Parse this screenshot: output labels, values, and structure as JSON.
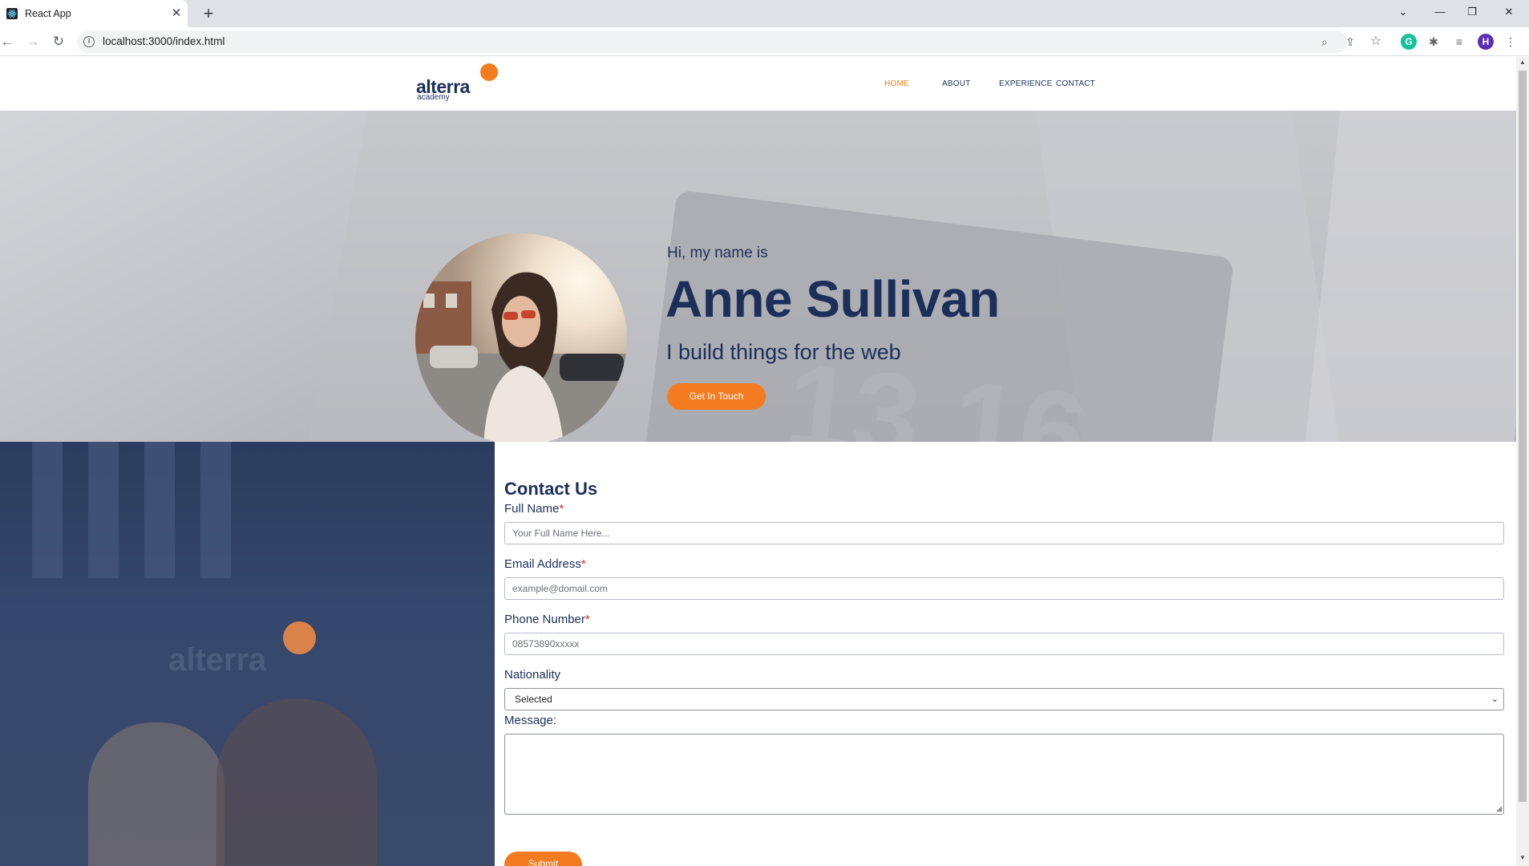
{
  "browser": {
    "tab_title": "React App",
    "tab_close": "✕",
    "new_tab": "+",
    "url": "localhost:3000/index.html",
    "profile_initial": "H",
    "window_controls": {
      "minimize": "—",
      "restore": "❐",
      "close": "✕",
      "tab_search": "⌄"
    }
  },
  "site": {
    "logo": {
      "word": "alterra",
      "sub": "academy",
      "accent": "#f47b20"
    },
    "nav": [
      {
        "label": "HOME",
        "active": true
      },
      {
        "label": "ABOUT",
        "active": false
      },
      {
        "label": "EXPERIENCE",
        "active": false
      },
      {
        "label": "CONTACT",
        "active": false
      }
    ]
  },
  "hero": {
    "greeting": "Hi, my name is",
    "name": "Anne Sullivan",
    "tagline": "I build things for the web",
    "cta": "Get In Touch",
    "background_text": "13 16"
  },
  "contact": {
    "title": "Contact Us",
    "full_name": {
      "label": "Full Name",
      "required": "*",
      "placeholder": "Your Full Name Here..."
    },
    "email": {
      "label": "Email Address",
      "required": "*",
      "placeholder": "example@domail.com"
    },
    "phone": {
      "label": "Phone Number",
      "required": "*",
      "placeholder": "08573890xxxxx"
    },
    "nationality": {
      "label": "Nationality",
      "selected": "Selected"
    },
    "message": {
      "label": "Message:"
    },
    "submit": "Submit"
  },
  "colors": {
    "brand_navy": "#1b2f5a",
    "brand_orange": "#f47b20"
  }
}
